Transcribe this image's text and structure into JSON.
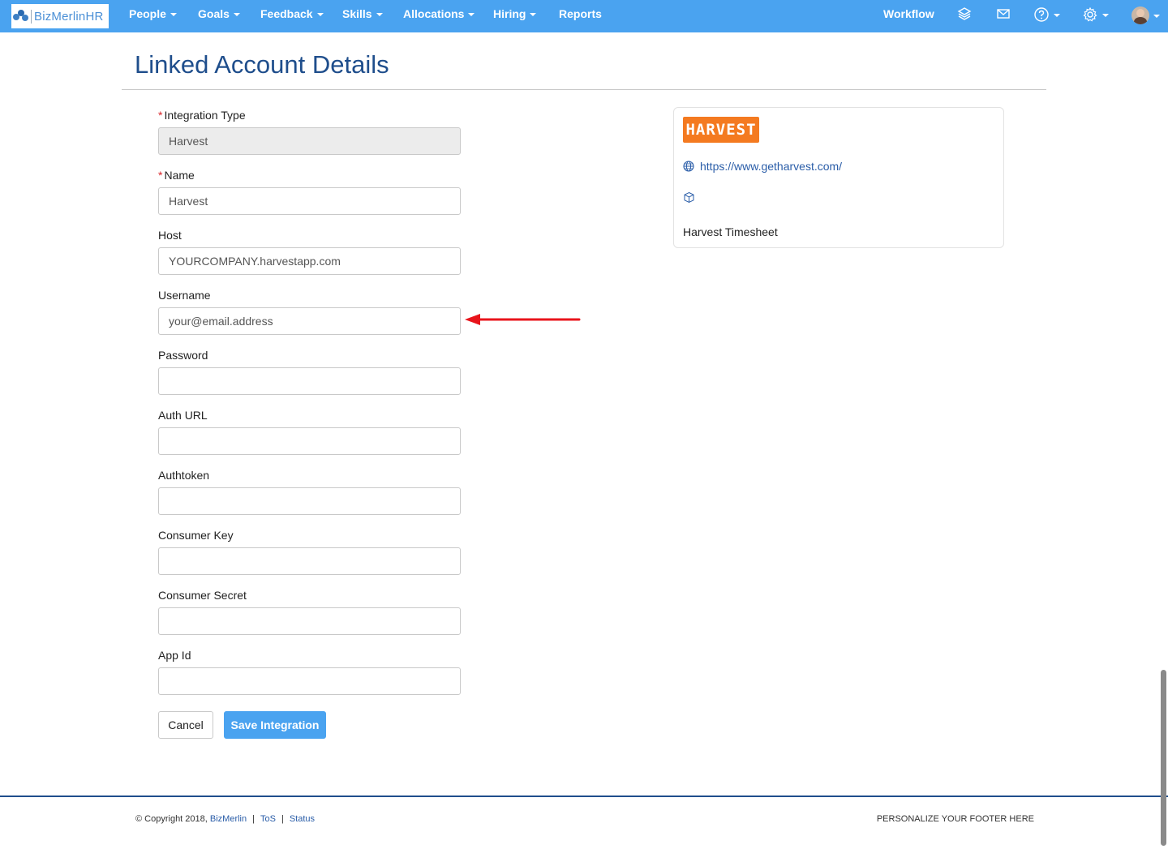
{
  "brand": {
    "name": "BizMerlinHR",
    "accent": "#4aa3f0",
    "title_color": "#1f4e8c"
  },
  "nav": {
    "items": [
      {
        "label": "People",
        "dropdown": true
      },
      {
        "label": "Goals",
        "dropdown": true
      },
      {
        "label": "Feedback",
        "dropdown": true
      },
      {
        "label": "Skills",
        "dropdown": true
      },
      {
        "label": "Allocations",
        "dropdown": true
      },
      {
        "label": "Hiring",
        "dropdown": true
      },
      {
        "label": "Reports",
        "dropdown": false
      }
    ],
    "workflow_label": "Workflow",
    "icons": [
      "layers-icon",
      "mail-icon",
      "help-icon",
      "gear-icon",
      "avatar"
    ]
  },
  "page": {
    "title": "Linked Account Details"
  },
  "form": {
    "integration_type": {
      "label": "Integration Type",
      "required": true,
      "value": "Harvest",
      "disabled": true
    },
    "name": {
      "label": "Name",
      "required": true,
      "value": "Harvest"
    },
    "host": {
      "label": "Host",
      "value": "YOURCOMPANY.harvestapp.com"
    },
    "username": {
      "label": "Username",
      "value": "your@email.address"
    },
    "password": {
      "label": "Password",
      "value": ""
    },
    "auth_url": {
      "label": "Auth URL",
      "value": ""
    },
    "authtoken": {
      "label": "Authtoken",
      "value": ""
    },
    "consumer_key": {
      "label": "Consumer Key",
      "value": ""
    },
    "consumer_secret": {
      "label": "Consumer Secret",
      "value": ""
    },
    "app_id": {
      "label": "App Id",
      "value": ""
    },
    "cancel_label": "Cancel",
    "save_label": "Save Integration"
  },
  "card": {
    "logo_text": "HARVEST",
    "logo_color": "#f47a20",
    "url": "https://www.getharvest.com/",
    "description": "Harvest Timesheet"
  },
  "annotation": {
    "arrow_color": "#e8141b",
    "target": "username"
  },
  "footer": {
    "copyright": "© Copyright 2018,",
    "company_link": "BizMerlin",
    "tos_link": "ToS",
    "status_link": "Status",
    "right_text": "PERSONALIZE YOUR FOOTER HERE"
  }
}
